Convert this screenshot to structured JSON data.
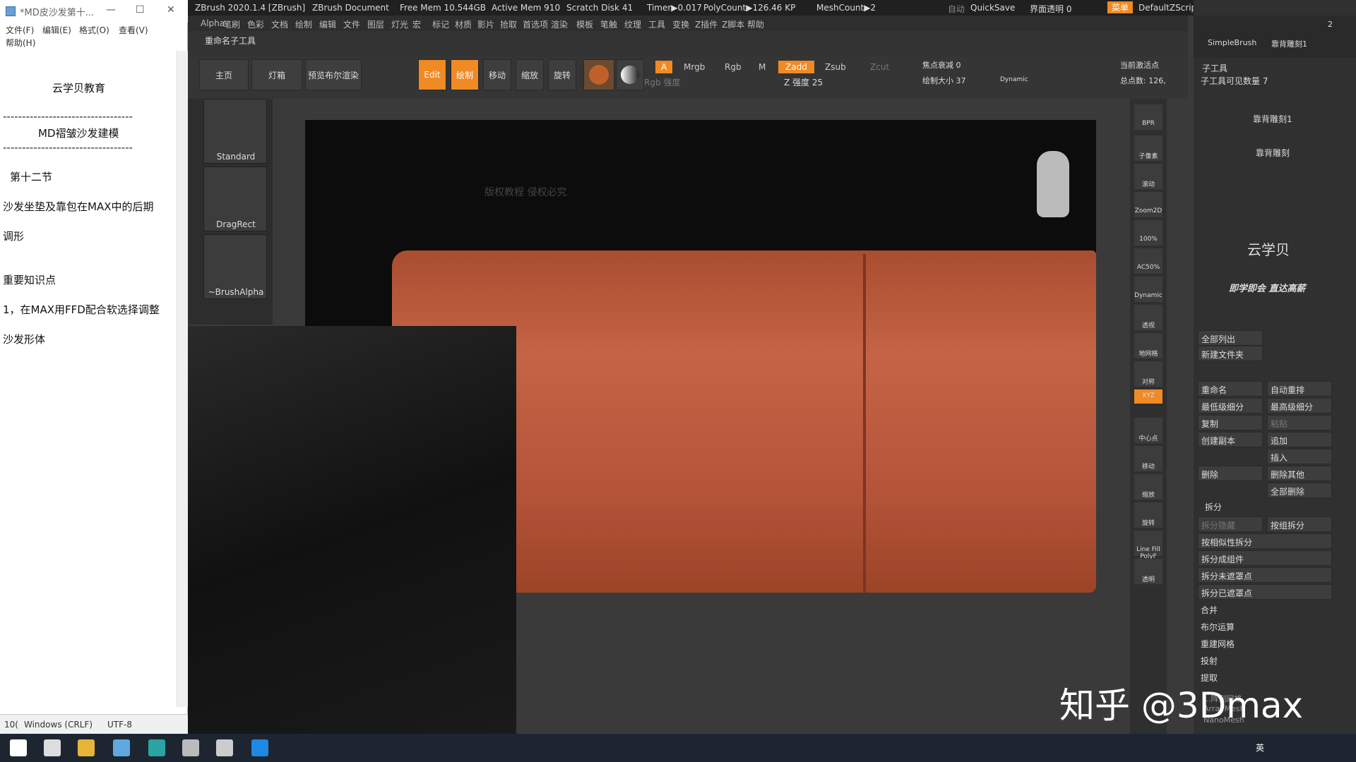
{
  "notepad": {
    "title": "*MD皮沙发第十...",
    "menu": [
      "文件(F)",
      "编辑(E)",
      "格式(O)",
      "查看(V)",
      "帮助(H)"
    ],
    "lines": [
      "云学贝教育",
      "----------------------------------",
      "MD褶皱沙发建模",
      "----------------------------------",
      "第十二节",
      "沙发坐垫及靠包在MAX中的后期",
      "调形",
      "重要知识点",
      "1，在MAX用FFD配合软选择调整",
      "沙发形体"
    ],
    "status": {
      "zoom": "10(",
      "eol": "Windows (CRLF)",
      "encoding": "UTF-8"
    }
  },
  "zbrush": {
    "titlebar": [
      "ZBrush 2020.1.4 [ZBrush]",
      "ZBrush Document",
      "Free Mem 10.544GB",
      "Active Mem 910",
      "Scratch Disk 41",
      "Timer▶0.017",
      "PolyCount▶126.46 KP",
      "MeshCount▶2",
      "自动",
      "QuickSave",
      "界面透明 0",
      "菜单",
      "DefaultZScript"
    ],
    "menu": [
      "Alpha",
      "笔刷",
      "色彩",
      "文档",
      "绘制",
      "编辑",
      "文件",
      "图层",
      "灯光",
      "宏",
      "标记",
      "材质",
      "影片",
      "拾取",
      "首选项",
      "渲染",
      "模板",
      "笔触",
      "纹理",
      "工具",
      "变换",
      "Z插件",
      "Z脚本",
      "帮助"
    ],
    "sub_label": "重命名子工具",
    "tabs": [
      "主页",
      "灯箱",
      "预览布尔渲染"
    ],
    "tools": [
      "Edit",
      "绘制",
      "移动",
      "缩放",
      "旋转"
    ],
    "modes": {
      "a": "A",
      "mrgb": "Mrgb",
      "rgb": "Rgb",
      "m": "M",
      "zadd": "Zadd",
      "zsub": "Zsub",
      "zcut": "Zcut",
      "rgb_strength": "Rgb 强度",
      "z_strength": "Z 强度 25",
      "focal": "焦点衰减 0",
      "draw_size": "绘制大小 37",
      "dynamic": "Dynamic",
      "active": "当前激活点",
      "total": "总点数: 126,"
    },
    "brushes": [
      "Standard",
      "DragRect",
      "~BrushAlpha"
    ],
    "canvas_watermark": "版权教程 侵权必究",
    "right_shelf": [
      "BPR",
      "子像素",
      "滚动",
      "Zoom2D",
      "100%",
      "AC50%",
      "Dynamic",
      "透视",
      "地网格",
      "对称",
      "XYZ",
      "中心点",
      "移动",
      "缩放",
      "旋转",
      "Line Fill PolyF",
      "透明"
    ],
    "tray": {
      "top_labels": [
        "SimpleBrush",
        "靠背雕刻1"
      ],
      "top_count": "2",
      "subtool_title": "子工具",
      "visible_count": "子工具可见数量 7",
      "subtools": [
        "靠背雕刻1",
        "靠背雕刻"
      ],
      "logo_text": "云学贝",
      "slogan": "即学即会 直达高薪",
      "buttons": [
        [
          "全部列出",
          ""
        ],
        [
          "新建文件夹",
          ""
        ],
        [
          "重命名",
          "自动重排"
        ],
        [
          "最低级细分",
          "最高级细分"
        ],
        [
          "复制",
          "粘贴"
        ],
        [
          "创建副本",
          "追加"
        ],
        [
          "",
          "插入"
        ],
        [
          "删除",
          "删除其他"
        ],
        [
          "",
          "全部删除"
        ]
      ],
      "split_title": "拆分",
      "split_items": [
        "拆分隐藏",
        "按组拆分",
        "按相似性拆分",
        "拆分成组件",
        "拆分未遮罩点",
        "拆分已遮罩点"
      ],
      "more_items": [
        "合并",
        "布尔运算",
        "重建网格",
        "投射",
        "提取"
      ],
      "bottom": [
        "...阵列网格",
        "ArrayMesh",
        "NanoMesh"
      ]
    }
  },
  "watermark": "知乎 @3Dmax",
  "taskbar": {
    "ime": "英",
    "icons": [
      "windows-icon",
      "search-icon",
      "explorer-icon",
      "notepad-icon",
      "3dsmax-icon",
      "webcam-icon",
      "zbrush-icon",
      "recorder-icon"
    ]
  }
}
